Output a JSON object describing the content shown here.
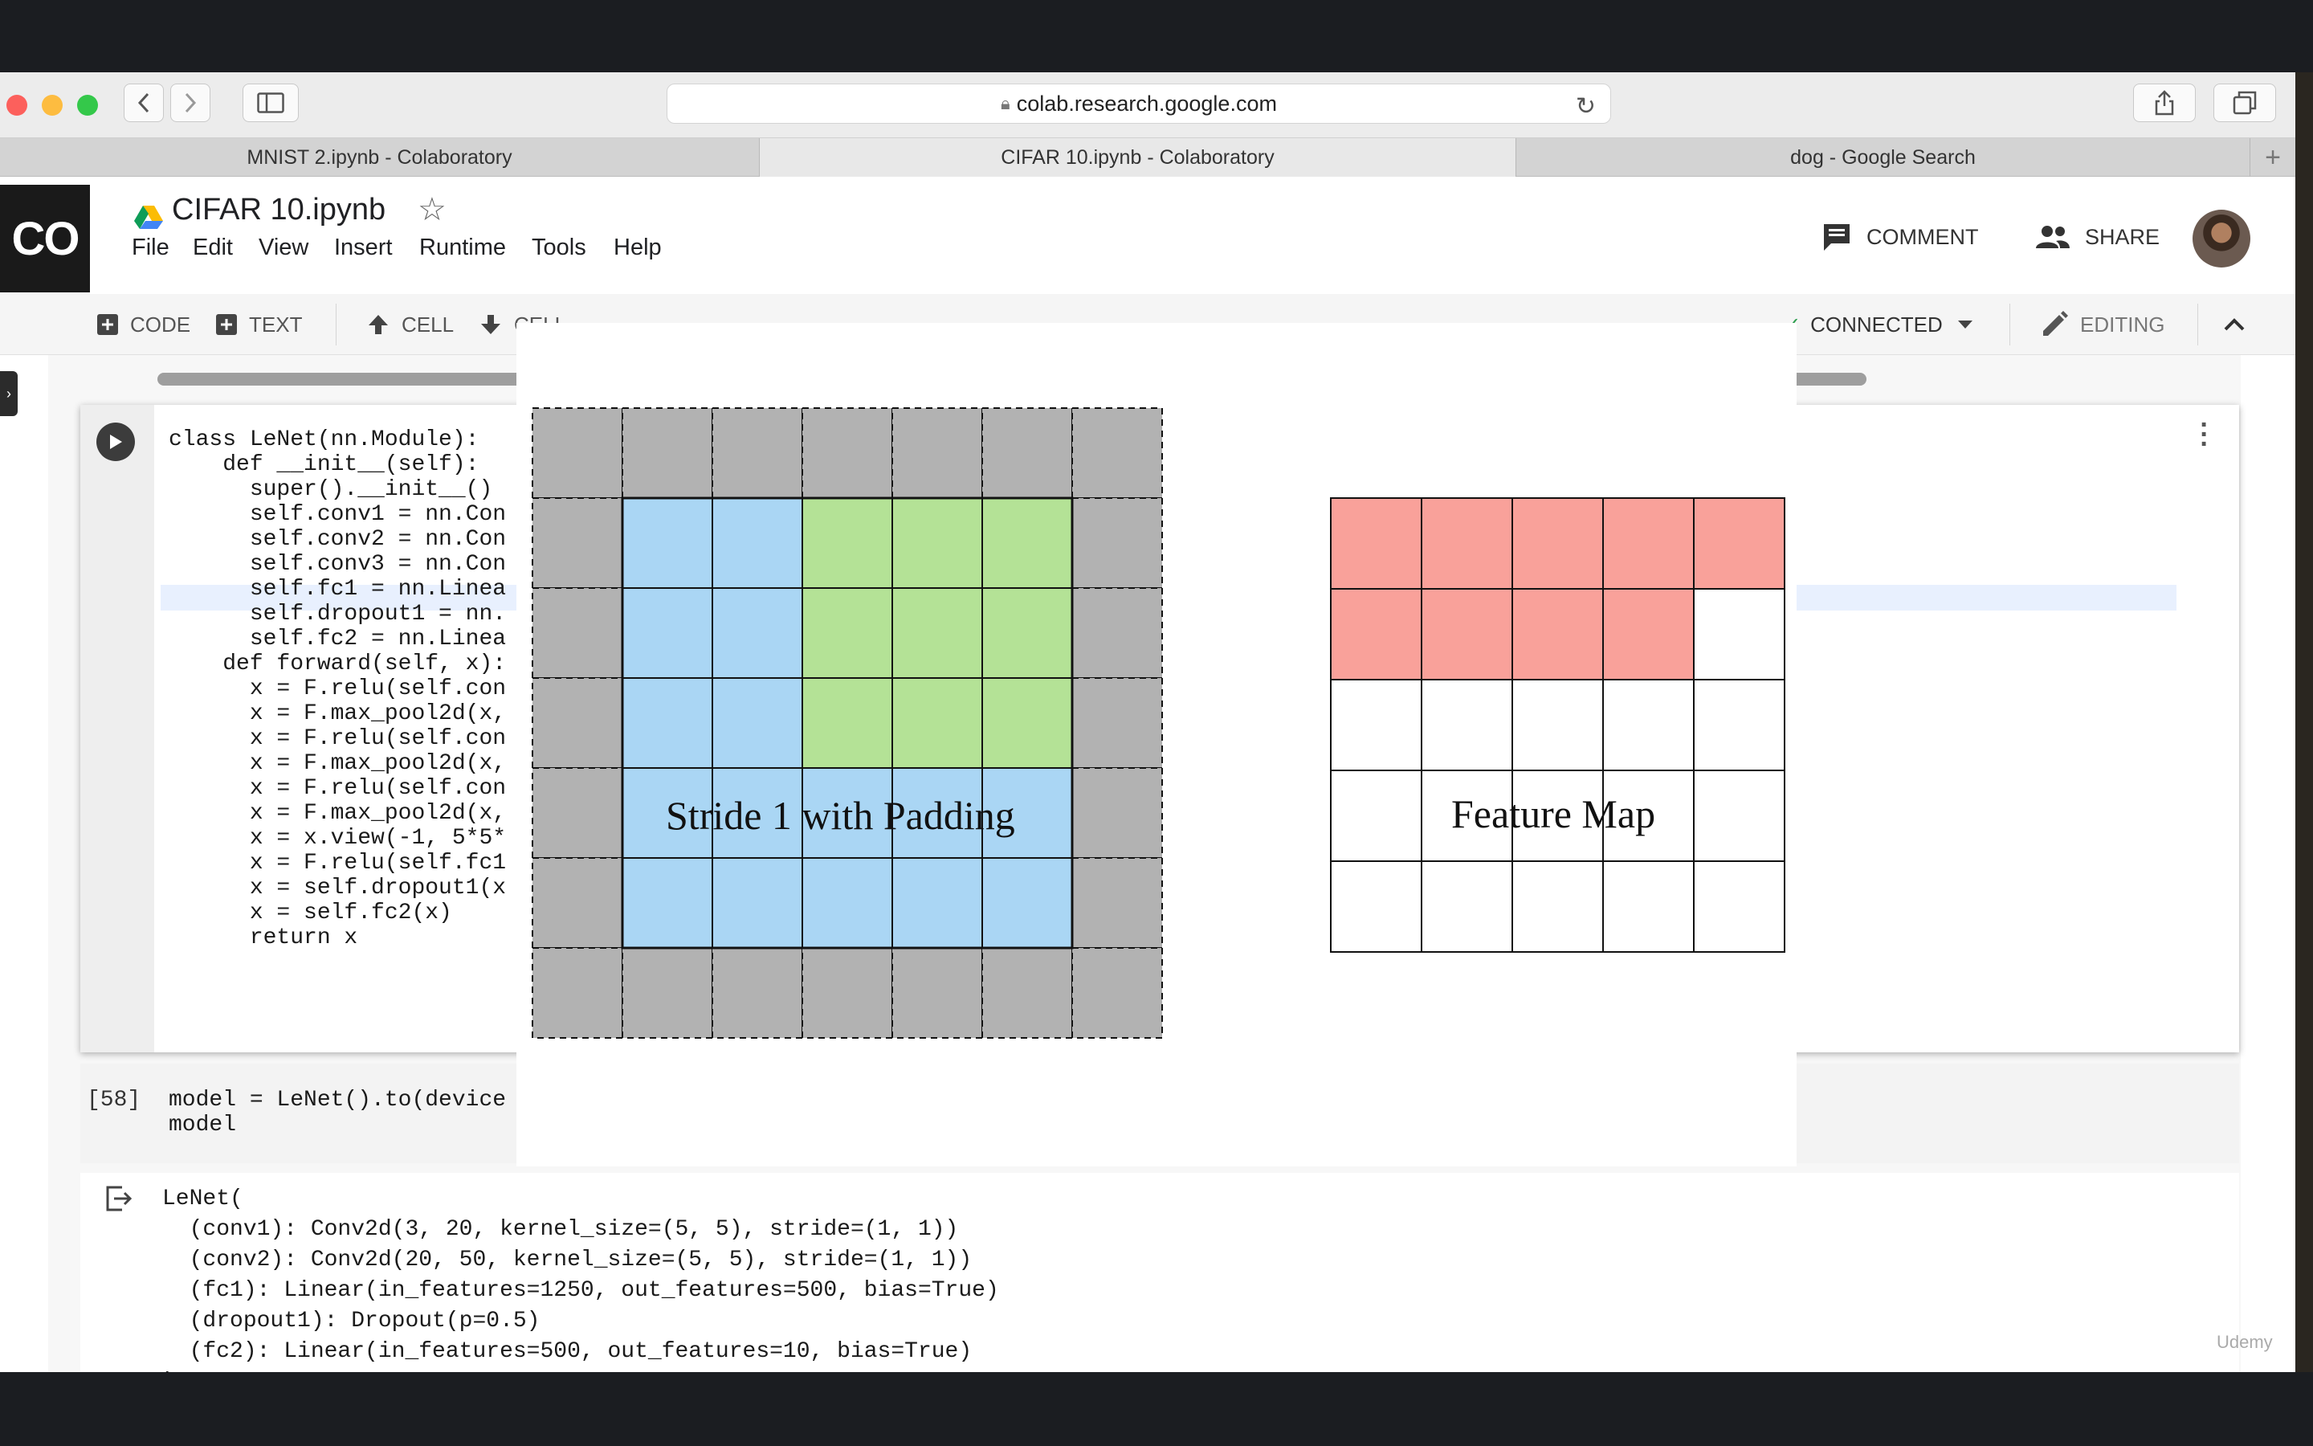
{
  "browser": {
    "url": "colab.research.google.com",
    "tabs": [
      {
        "title": "MNIST 2.ipynb - Colaboratory",
        "active": false
      },
      {
        "title": "CIFAR 10.ipynb - Colaboratory",
        "active": true
      },
      {
        "title": "dog - Google Search",
        "active": false
      }
    ]
  },
  "colab": {
    "logo": "CO",
    "notebook_title": "CIFAR 10.ipynb",
    "menu": [
      "File",
      "Edit",
      "View",
      "Insert",
      "Runtime",
      "Tools",
      "Help"
    ],
    "comment_label": "COMMENT",
    "share_label": "SHARE",
    "toolbar": {
      "code_label": "CODE",
      "text_label": "TEXT",
      "cell_up_label": "CELL",
      "cell_down_label": "CELL",
      "connected_label": "CONNECTED",
      "editing_label": "EDITING"
    }
  },
  "cells": {
    "code_lines": [
      "class LeNet(nn.Module):",
      "    def __init__(self):",
      "      super().__init__()",
      "      self.conv1 = nn.Con",
      "      self.conv2 = nn.Con",
      "      self.conv3 = nn.Con",
      "      self.fc1 = nn.Linea",
      "      self.dropout1 = nn.",
      "      self.fc2 = nn.Linea",
      "    def forward(self, x):",
      "      x = F.relu(self.con",
      "      x = F.max_pool2d(x,",
      "      x = F.relu(self.con",
      "      x = F.max_pool2d(x,",
      "      x = F.relu(self.con",
      "      x = F.max_pool2d(x,",
      "      x = x.view(-1, 5*5*",
      "      x = F.relu(self.fc1",
      "      x = self.dropout1(x",
      "      x = self.fc2(x)",
      "      return x"
    ],
    "cell2_count": "[58]",
    "cell2_lines": [
      "model = LeNet().to(device",
      "model"
    ],
    "output_lines": [
      "LeNet(",
      "  (conv1): Conv2d(3, 20, kernel_size=(5, 5), stride=(1, 1))",
      "  (conv2): Conv2d(20, 50, kernel_size=(5, 5), stride=(1, 1))",
      "  (fc1): Linear(in_features=1250, out_features=500, bias=True)",
      "  (dropout1): Dropout(p=0.5)",
      "  (fc2): Linear(in_features=500, out_features=10, bias=True)",
      ")"
    ]
  },
  "figure": {
    "input_grid": {
      "size": 7,
      "padding_color": "#b2b2b2",
      "input_color": "#aad6f4",
      "kernel_color": "#b4e296",
      "kernel_rows": [
        1,
        2,
        3
      ],
      "kernel_cols": [
        3,
        4,
        5
      ]
    },
    "feature_map": {
      "size": 5,
      "filled_color": "#f9a19a",
      "filled_cells": 9
    },
    "captions": {
      "left": "Stride 1 with Padding",
      "right": "Feature Map"
    }
  },
  "watermark": "Udemy"
}
